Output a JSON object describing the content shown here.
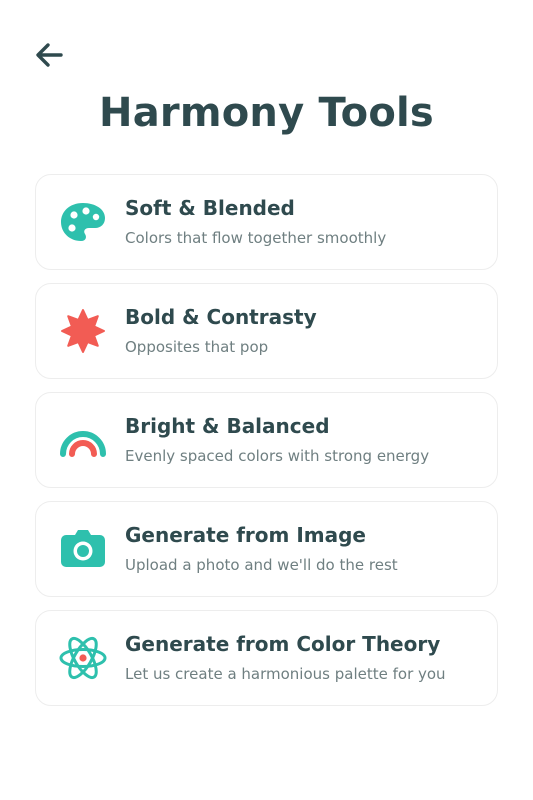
{
  "header": {
    "back_icon": "arrow-left-icon",
    "title": "Harmony Tools"
  },
  "colors": {
    "teal": "#2ec0ad",
    "coral": "#f25c54",
    "heading": "#2f4a4e",
    "subtext": "#6f7f81",
    "card_border": "#ededed"
  },
  "tools": [
    {
      "icon": "palette-icon",
      "title": "Soft & Blended",
      "description": "Colors that flow together smoothly"
    },
    {
      "icon": "starburst-icon",
      "title": "Bold & Contrasty",
      "description": "Opposites that pop"
    },
    {
      "icon": "rainbow-icon",
      "title": "Bright & Balanced",
      "description": "Evenly spaced colors with strong energy"
    },
    {
      "icon": "camera-icon",
      "title": "Generate from Image",
      "description": "Upload a photo and we'll do the rest"
    },
    {
      "icon": "atom-icon",
      "title": "Generate from Color Theory",
      "description": "Let us create a harmonious palette for you"
    }
  ]
}
